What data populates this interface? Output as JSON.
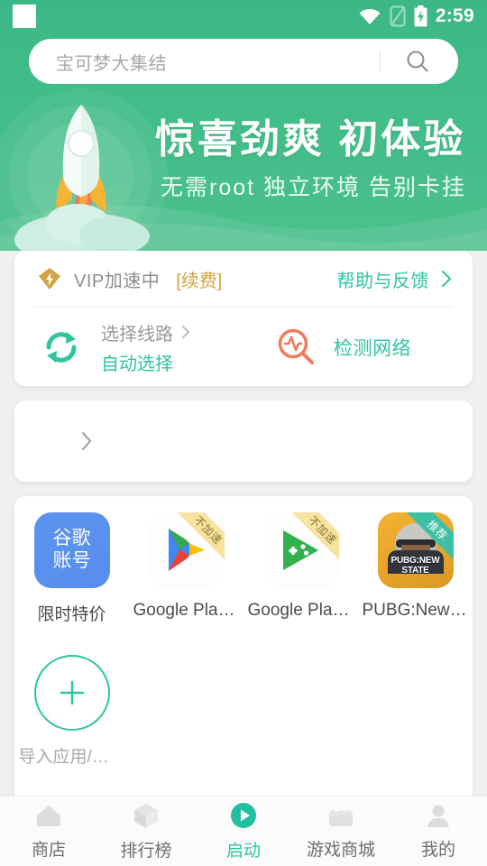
{
  "statusbar": {
    "time": "2:59",
    "icons": [
      "wifi-icon",
      "sim-off-icon",
      "battery-charging-icon"
    ]
  },
  "search": {
    "placeholder": "宝可梦大集结",
    "icon": "search-icon"
  },
  "banner": {
    "title": "惊喜劲爽  初体验",
    "subtitle": "无需root  独立环境  告别卡挂",
    "illustration": "rocket-launch-illustration",
    "bg_color": "#41bd88"
  },
  "vip_card": {
    "gem_icon": "vip-gem-icon",
    "status_label": "VIP加速中",
    "renew_label": "[续费]",
    "renew_color": "#d3a441",
    "help_label": "帮助与反馈",
    "help_chevron": "chevron-right-icon",
    "route": {
      "icon": "sync-refresh-icon",
      "title": "选择线路",
      "chevron": "chevron-right-icon",
      "value": "自动选择",
      "value_color": "#2ec5a0"
    },
    "network_check": {
      "icon": "network-pulse-search-icon",
      "label": "检测网络",
      "icon_color": "#f4795b"
    }
  },
  "promo_card": {
    "chevron": "chevron-right-icon"
  },
  "apps": [
    {
      "icon_kind": "google-account",
      "icon_line1": "谷歌",
      "icon_line2": "账号",
      "label": "限时特价",
      "badge": "",
      "badge_kind": ""
    },
    {
      "icon_kind": "play-store",
      "icon_line1": "",
      "icon_line2": "",
      "label": "Google Play ...",
      "badge": "不加速",
      "badge_kind": "yellow"
    },
    {
      "icon_kind": "play-games",
      "icon_line1": "",
      "icon_line2": "",
      "label": "Google Play ...",
      "badge": "不加速",
      "badge_kind": "yellow"
    },
    {
      "icon_kind": "pubg",
      "icon_line1": "",
      "icon_line2": "",
      "label": "PUBG:New S...",
      "badge": "推荐",
      "badge_kind": "teal",
      "icon_text": "PUBG:NEW STATE"
    }
  ],
  "add_tile": {
    "icon": "plus-icon",
    "label": "导入应用/游戏"
  },
  "bottom_nav": {
    "active_color": "#2ec5a0",
    "items": [
      {
        "label": "商店",
        "icon": "home-icon",
        "active": false
      },
      {
        "label": "排行榜",
        "icon": "cube-icon",
        "active": false
      },
      {
        "label": "启动",
        "icon": "play-circle-icon",
        "active": true
      },
      {
        "label": "游戏商城",
        "icon": "store-icon",
        "active": false
      },
      {
        "label": "我的",
        "icon": "person-icon",
        "active": false
      }
    ]
  }
}
